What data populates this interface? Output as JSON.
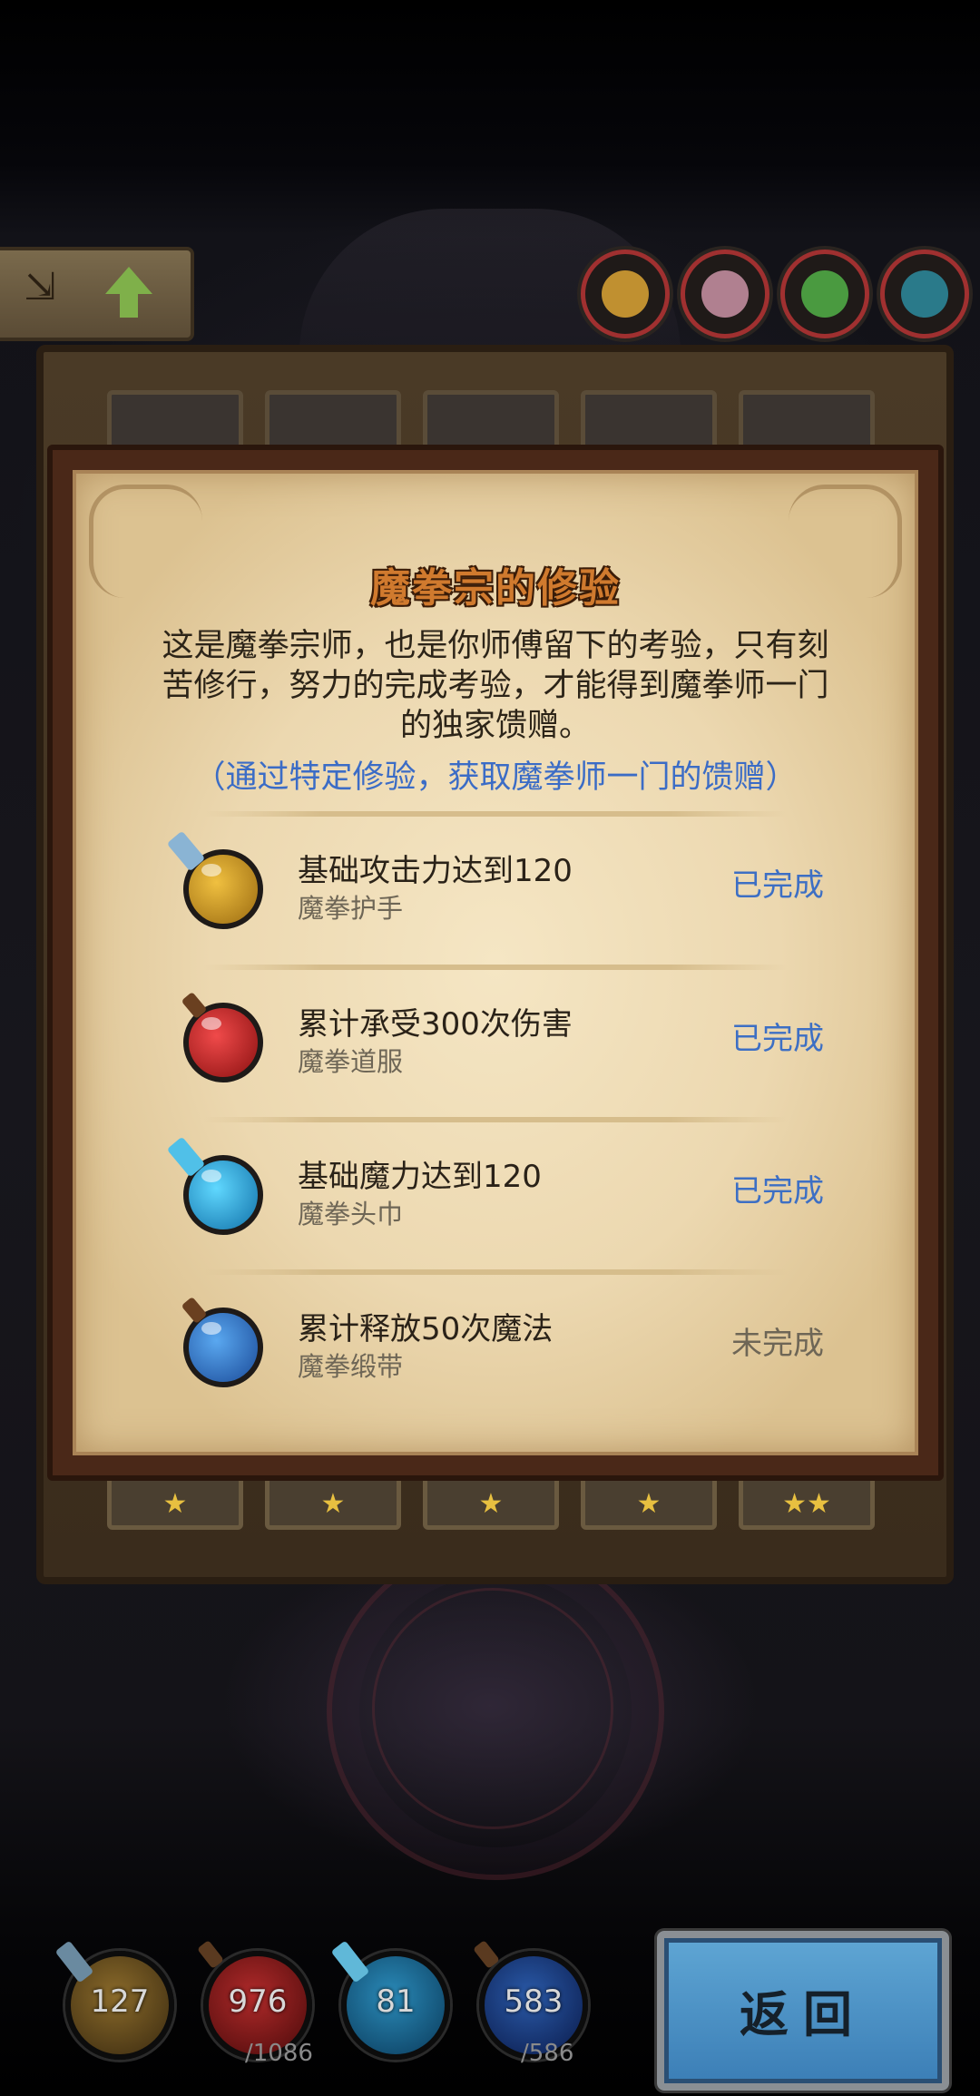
{
  "hud_top": {
    "badge_label": "⇲"
  },
  "dialog": {
    "title": "魔拳宗的修验",
    "description": "这是魔拳宗师，也是你师傅留下的考验，只有刻苦修行，努力的完成考验，才能得到魔拳师一门的独家馈赠。",
    "hint": "（通过特定修验，获取魔拳师一门的馈赠）",
    "trials": [
      {
        "task": "基础攻击力达到120",
        "reward": "魔拳护手",
        "status": "已完成",
        "icon": "attack-orb-icon",
        "color": "#c8921e"
      },
      {
        "task": "累计承受300次伤害",
        "reward": "魔拳道服",
        "status": "已完成",
        "icon": "health-orb-icon",
        "color": "#c42a2a"
      },
      {
        "task": "基础魔力达到120",
        "reward": "魔拳头巾",
        "status": "已完成",
        "icon": "magic-orb-icon",
        "color": "#2aa0d8"
      },
      {
        "task": "累计释放50次魔法",
        "reward": "魔拳缎带",
        "status": "未完成",
        "icon": "mana-orb-icon",
        "color": "#2a78c8"
      }
    ]
  },
  "status_colors": {
    "done": "#3d6fc4",
    "undone": "#6e6656"
  },
  "stats": {
    "attack": "127",
    "health": "976",
    "health_max": "/1086",
    "magic": "81",
    "mana": "583",
    "mana_max": "/586"
  },
  "back_button": "返回"
}
